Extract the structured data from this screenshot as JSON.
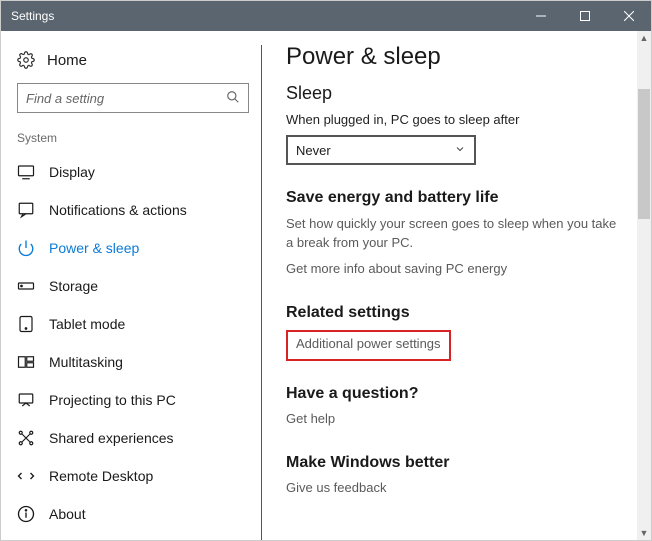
{
  "window": {
    "title": "Settings"
  },
  "sidebar": {
    "home": "Home",
    "search_placeholder": "Find a setting",
    "group": "System",
    "items": [
      {
        "label": "Display"
      },
      {
        "label": "Notifications & actions"
      },
      {
        "label": "Power & sleep"
      },
      {
        "label": "Storage"
      },
      {
        "label": "Tablet mode"
      },
      {
        "label": "Multitasking"
      },
      {
        "label": "Projecting to this PC"
      },
      {
        "label": "Shared experiences"
      },
      {
        "label": "Remote Desktop"
      },
      {
        "label": "About"
      }
    ]
  },
  "content": {
    "h1": "Power & sleep",
    "sleep": {
      "heading": "Sleep",
      "label": "When plugged in, PC goes to sleep after",
      "value": "Never"
    },
    "energy": {
      "heading": "Save energy and battery life",
      "desc": "Set how quickly your screen goes to sleep when you take a break from your PC.",
      "link": "Get more info about saving PC energy"
    },
    "related": {
      "heading": "Related settings",
      "link": "Additional power settings"
    },
    "question": {
      "heading": "Have a question?",
      "link": "Get help"
    },
    "better": {
      "heading": "Make Windows better",
      "link": "Give us feedback"
    }
  }
}
